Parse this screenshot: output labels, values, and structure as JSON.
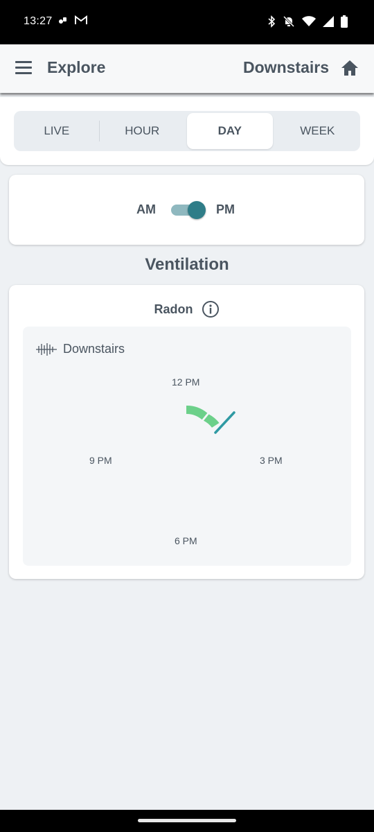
{
  "status_bar": {
    "time": "13:27",
    "icons": [
      "photos-icon",
      "gmail-icon",
      "bluetooth-icon",
      "mute-icon",
      "wifi-icon",
      "signal-icon",
      "battery-icon"
    ]
  },
  "app_bar": {
    "title": "Explore",
    "location": "Downstairs",
    "menu_icon": "hamburger-menu-icon",
    "home_icon": "home-icon"
  },
  "tabs": {
    "items": [
      {
        "label": "LIVE",
        "active": false
      },
      {
        "label": "HOUR",
        "active": false
      },
      {
        "label": "DAY",
        "active": true
      },
      {
        "label": "WEEK",
        "active": false
      }
    ]
  },
  "period_toggle": {
    "left_label": "AM",
    "right_label": "PM",
    "selected": "PM"
  },
  "section": {
    "title": "Ventilation"
  },
  "radon_card": {
    "title": "Radon",
    "info_icon": "info-icon",
    "device_icon": "airthings-wave-icon",
    "device_name": "Downstairs",
    "clock_labels": {
      "top": "12 PM",
      "right": "3 PM",
      "bottom": "6 PM",
      "left": "9 PM"
    },
    "colors": {
      "level_good": "#6cd08a",
      "current_marker": "#2f9aa3"
    }
  },
  "colors": {
    "background": "#eef1f4",
    "text": "#4a5560",
    "accent": "#2f7d88"
  }
}
